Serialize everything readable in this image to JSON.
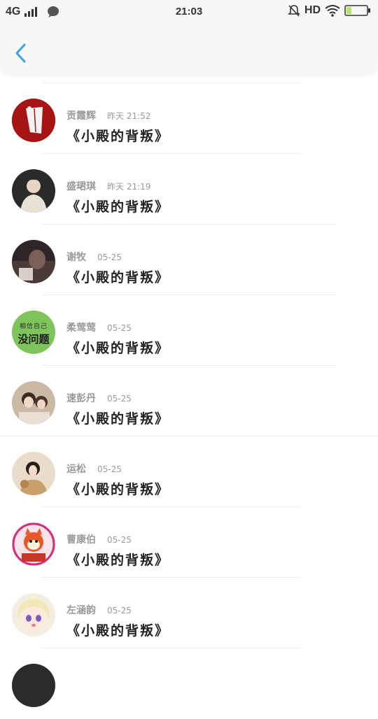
{
  "status_bar": {
    "network": "4G",
    "time": "21:03",
    "hd_label": "HD",
    "accent_battery": "#b6e36a"
  },
  "header": {
    "back_icon": "chevron-left-icon",
    "accent": "#3aa3e3"
  },
  "items": [
    {
      "name": "贡霞辉",
      "time": "昨天 21:52",
      "title": "《小殿的背叛》",
      "avatar_color": "#b31b1b"
    },
    {
      "name": "盛珺琪",
      "time": "昨天 21:19",
      "title": "《小殿的背叛》",
      "avatar_color": "#2a2a2a"
    },
    {
      "name": "谢牧",
      "time": "05-25",
      "title": "《小殿的背叛》",
      "avatar_color": "#3b3030"
    },
    {
      "name": "柔莺莺",
      "time": "05-25",
      "title": "《小殿的背叛》",
      "avatar_color": "#7dc45a",
      "avatar_text_1": "相信自己",
      "avatar_text_2": "没问题"
    },
    {
      "name": "速彭丹",
      "time": "05-25",
      "title": "《小殿的背叛》",
      "avatar_color": "#c8b8a8"
    },
    {
      "name": "运松",
      "time": "05-25",
      "title": "《小殿的背叛》",
      "avatar_color": "#e8d6c0"
    },
    {
      "name": "曹康伯",
      "time": "05-25",
      "title": "《小殿的背叛》",
      "avatar_color": "#f3e6e6"
    },
    {
      "name": "左涵韵",
      "time": "05-25",
      "title": "《小殿的背叛》",
      "avatar_color": "#f4eee0"
    },
    {
      "name": "",
      "time": "",
      "title": "",
      "avatar_color": "#2b2b2b"
    }
  ]
}
